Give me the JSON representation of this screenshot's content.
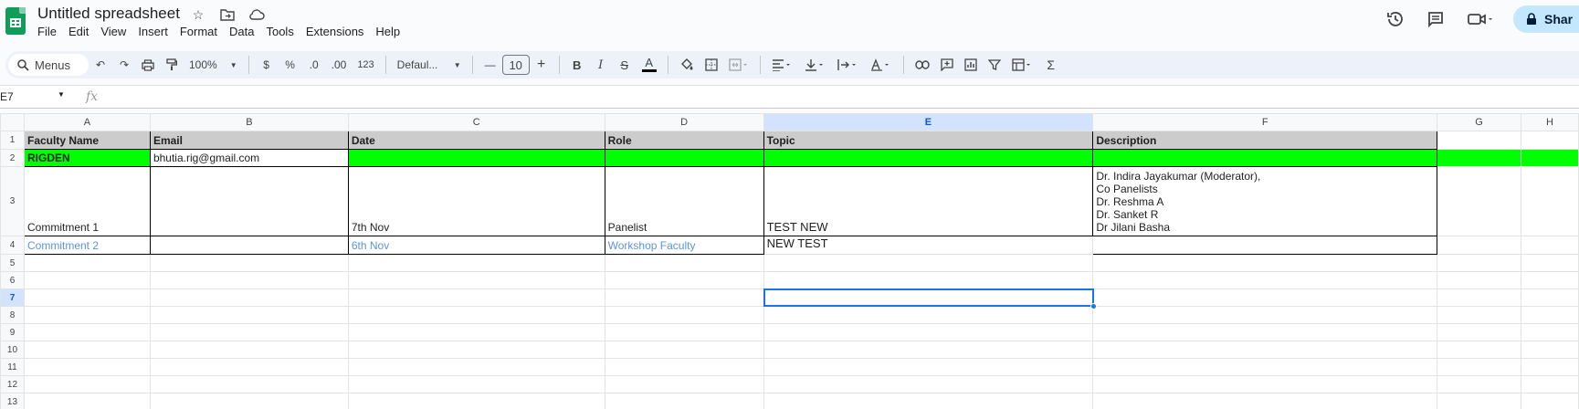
{
  "app": {
    "title": "Untitled spreadsheet",
    "share_label": "Shar"
  },
  "menu": [
    "File",
    "Edit",
    "View",
    "Insert",
    "Format",
    "Data",
    "Tools",
    "Extensions",
    "Help"
  ],
  "toolbar": {
    "menus_label": "Menus",
    "zoom": "100%",
    "currency": "$",
    "percent": "%",
    "dec_decrease": ".0",
    "dec_increase": ".00",
    "number_format": "123",
    "font": "Defaul...",
    "font_size": "10",
    "bold": "B",
    "italic": "I",
    "strike": "S",
    "text_color": "A",
    "sum": "Σ"
  },
  "formula_bar": {
    "cell_ref": "E7",
    "fx": "fx",
    "content": ""
  },
  "columns": [
    "A",
    "B",
    "C",
    "D",
    "E",
    "F",
    "G",
    "H"
  ],
  "rows": [
    "1",
    "2",
    "3",
    "4",
    "5",
    "6",
    "7",
    "8",
    "9",
    "10",
    "11",
    "12",
    "13"
  ],
  "cells": {
    "header": {
      "a": "Faculty Name",
      "b": "Email",
      "c": "Date",
      "d": "Role",
      "e": "Topic",
      "f": "Description"
    },
    "row2": {
      "a": "RIGDEN",
      "b": "bhutia.rig@gmail.com"
    },
    "row3": {
      "a": "Commitment 1",
      "c": "7th Nov",
      "d": "Panelist",
      "e": "TEST NEW",
      "f_lines": [
        "Dr. Indira Jayakumar (Moderator),",
        "Co Panelists",
        "Dr. Reshma A",
        "Dr. Sanket R",
        "Dr Jilani Basha"
      ]
    },
    "row4": {
      "a": "Commitment 2",
      "c": "6th Nov",
      "d": "Workshop Faculty",
      "e": "NEW TEST"
    }
  },
  "colors": {
    "green": "#00ff00",
    "header_gray": "#cccccc",
    "link_blue": "#5b95dd",
    "selection": "#1a73e8"
  }
}
